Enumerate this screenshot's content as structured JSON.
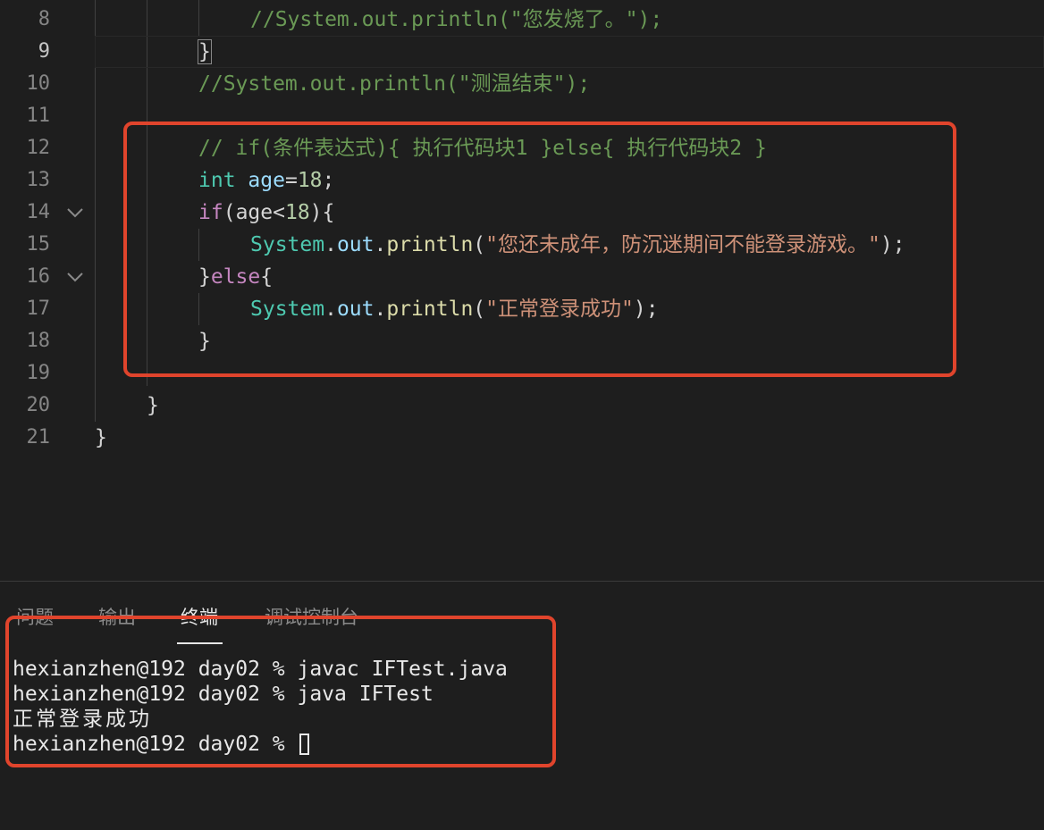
{
  "editor": {
    "lines": [
      {
        "num": "8",
        "comment": "//System.out.println(\"您发烧了。\");"
      },
      {
        "num": "9",
        "brace": "}"
      },
      {
        "num": "10",
        "comment": "//System.out.println(\"测温结束\");"
      },
      {
        "num": "11"
      },
      {
        "num": "12",
        "comment": "// if(条件表达式){ 执行代码块1 }else{ 执行代码块2 }"
      },
      {
        "num": "13",
        "type": "int",
        "var": "age",
        "op": "=",
        "num_val": "18",
        "end": ";"
      },
      {
        "num": "14",
        "kw": "if",
        "open": "(",
        "var": "age",
        "op": "<",
        "num_val": "18",
        "close": "){"
      },
      {
        "num": "15",
        "cls": "System",
        "dot1": ".",
        "field": "out",
        "dot2": ".",
        "fn": "println",
        "open": "(",
        "str": "\"您还未成年，防沉迷期间不能登录游戏。\"",
        "close": ");"
      },
      {
        "num": "16",
        "brace": "}",
        "kw": "else",
        "open": "{"
      },
      {
        "num": "17",
        "cls": "System",
        "dot1": ".",
        "field": "out",
        "dot2": ".",
        "fn": "println",
        "open": "(",
        "str": "\"正常登录成功\"",
        "close": ");"
      },
      {
        "num": "18",
        "brace": "}"
      },
      {
        "num": "19"
      },
      {
        "num": "20",
        "brace": "}"
      },
      {
        "num": "21",
        "brace": "}"
      }
    ]
  },
  "panel": {
    "tabs": [
      {
        "label": "问题"
      },
      {
        "label": "输出"
      },
      {
        "label": "终端"
      },
      {
        "label": "调试控制台"
      }
    ],
    "active_tab": "终端"
  },
  "terminal": {
    "lines": [
      "hexianzhen@192 day02 % javac IFTest.java",
      "hexianzhen@192 day02 % java IFTest",
      "正常登录成功",
      "hexianzhen@192 day02 % "
    ]
  },
  "colors": {
    "background": "#1e1e1e",
    "highlight_box": "#e0442c",
    "comment": "#6a9955",
    "keyword": "#c586c0",
    "type": "#4ec9b0",
    "string": "#ce9178",
    "function": "#dcdcaa",
    "variable": "#9cdcfe",
    "number": "#b5cea8"
  },
  "icons": {
    "fold": "chevron-down-icon"
  }
}
